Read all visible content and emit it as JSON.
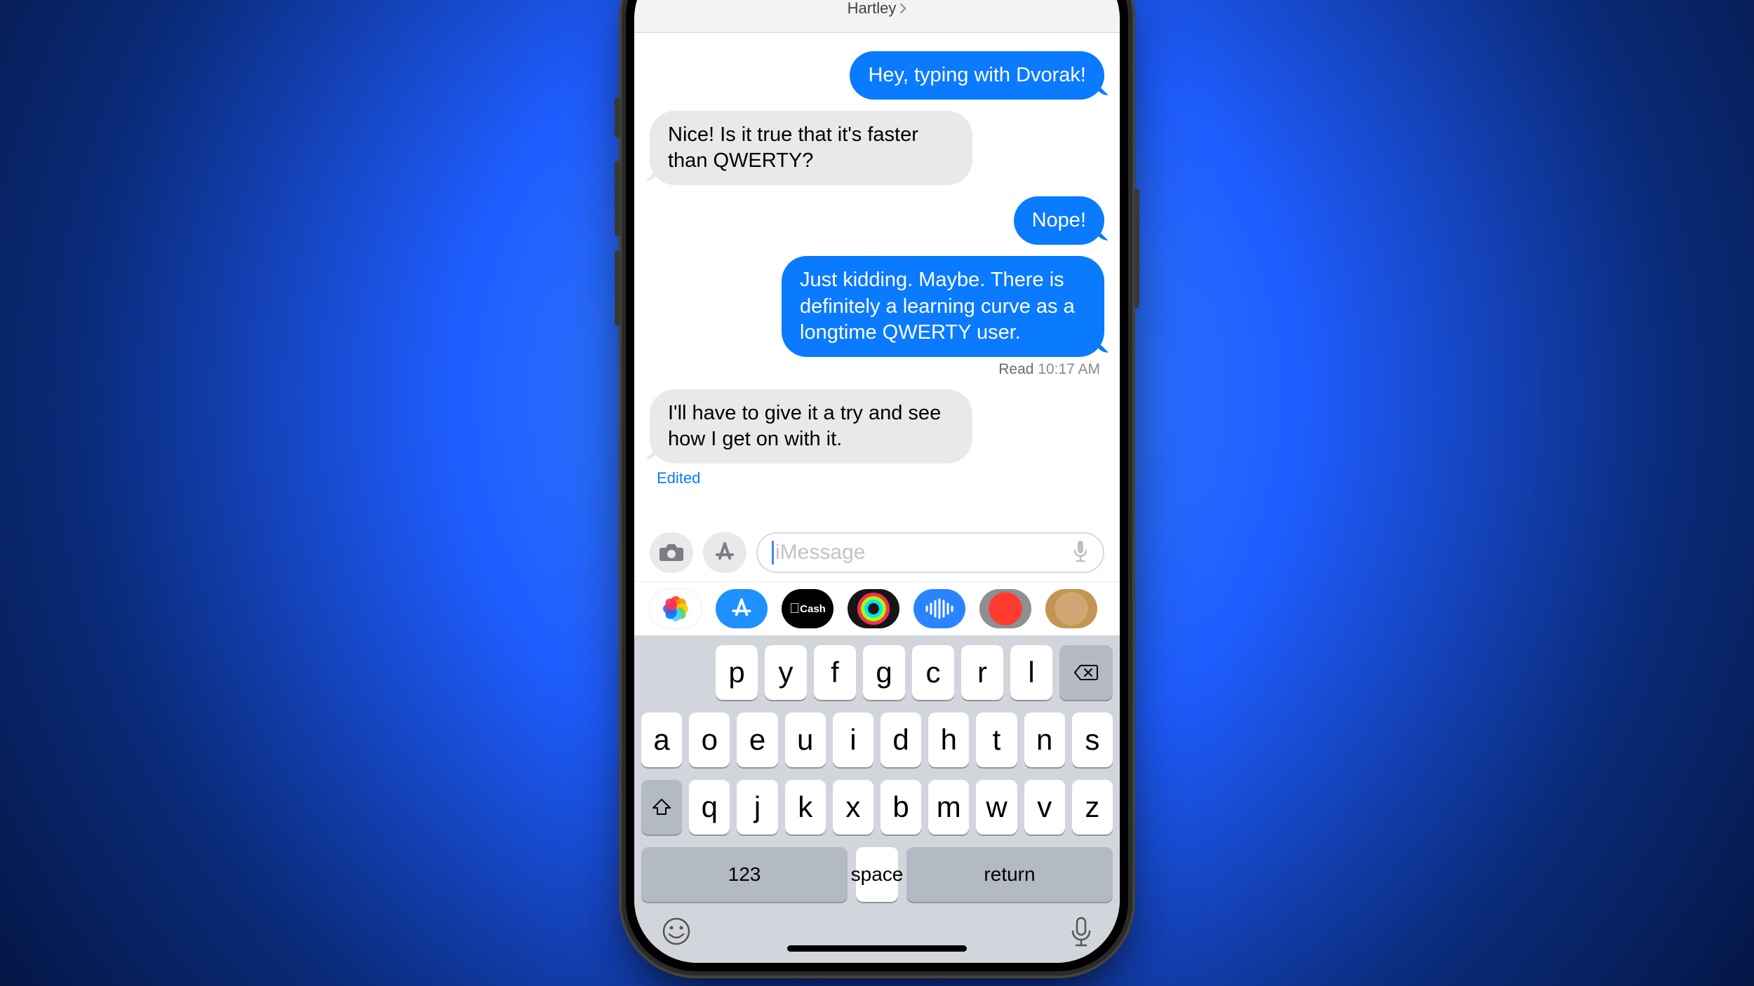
{
  "header": {
    "contact_name": "Hartley"
  },
  "messages": [
    {
      "side": "sent",
      "text": "Hey, typing with Dvorak!"
    },
    {
      "side": "recv",
      "text": "Nice! Is it true that it's faster than QWERTY?"
    },
    {
      "side": "sent",
      "text": "Nope!"
    },
    {
      "side": "sent",
      "text": "Just kidding. Maybe. There is definitely a learning curve as a longtime QWERTY user."
    }
  ],
  "receipt": {
    "label": "Read",
    "time": "10:17 AM"
  },
  "last_received": {
    "text": "I'll have to give it a try and see how I get on with it.",
    "edited_label": "Edited"
  },
  "composer": {
    "placeholder": "iMessage"
  },
  "apps": {
    "cash_label": "Cash"
  },
  "keyboard": {
    "row1": [
      "p",
      "y",
      "f",
      "g",
      "c",
      "r",
      "l"
    ],
    "row2": [
      "a",
      "o",
      "e",
      "u",
      "i",
      "d",
      "h",
      "t",
      "n",
      "s"
    ],
    "row3": [
      "q",
      "j",
      "k",
      "x",
      "b",
      "m",
      "w",
      "v",
      "z"
    ],
    "numbers_label": "123",
    "space_label": "space",
    "return_label": "return"
  }
}
